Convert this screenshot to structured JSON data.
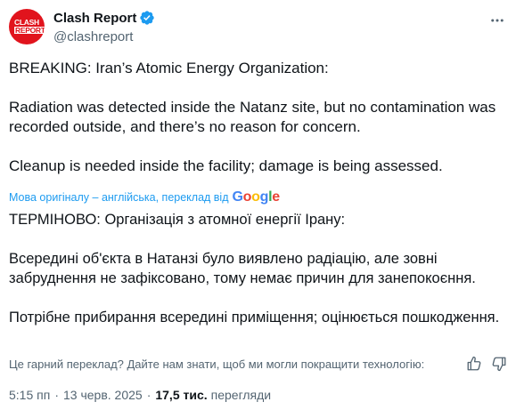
{
  "author": {
    "display_name": "Clash Report",
    "handle": "@clashreport",
    "avatar_text_line1": "CLASH",
    "avatar_text_line2": "REPORT"
  },
  "tweet": {
    "lines": [
      "BREAKING: Iran’s Atomic Energy Organization:",
      "Radiation was detected inside the Natanz site, but no contamination was recorded outside, and there’s no reason for concern.",
      "Cleanup is needed inside the facility; damage is being assessed."
    ]
  },
  "translation": {
    "note": "Мова оригіналу – англійська, переклад від",
    "provider": "Google",
    "lines": [
      "ТЕРМІНОВО: Організація з атомної енергії Ірану:",
      "Всередині об'єкта в Натанзі було виявлено радіацію, але зовні забруднення не зафіксовано, тому немає причин для занепокоєння.",
      "Потрібне прибирання всередині приміщення; оцінюється пошкодження."
    ]
  },
  "feedback": {
    "text": "Це гарний переклад? Дайте нам знати, щоб ми могли покращити технологію:"
  },
  "meta": {
    "time": "5:15 пп",
    "date": "13 черв. 2025",
    "views_count": "17,5 тис.",
    "views_label": "перегляди"
  },
  "colors": {
    "verified": "#1d9bf0",
    "link": "#1d9bf0",
    "secondary_text": "#536471",
    "avatar_bg": "#e1141d"
  }
}
